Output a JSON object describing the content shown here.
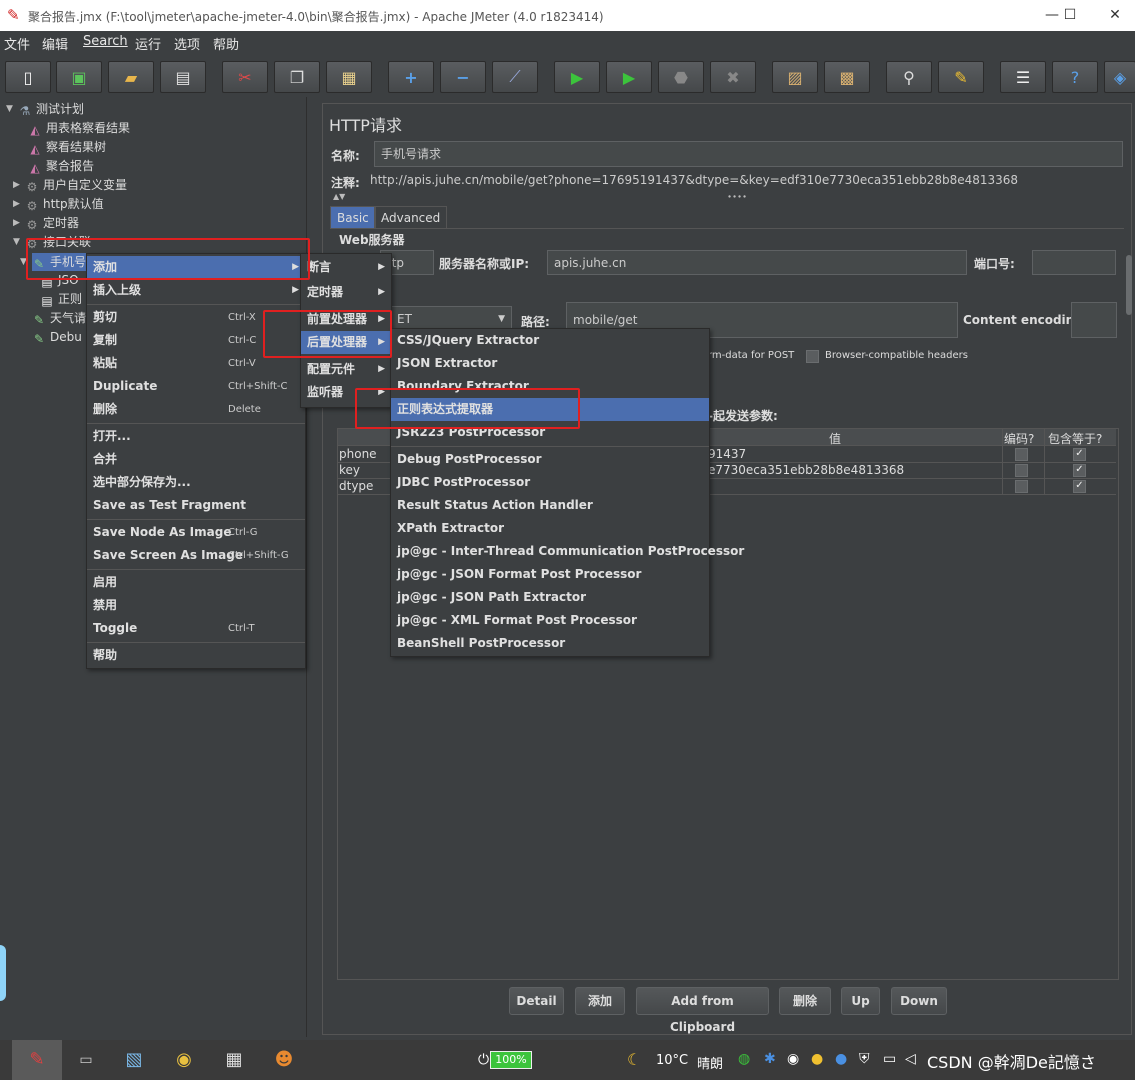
{
  "window": {
    "title": "聚合报告.jmx (F:\\tool\\jmeter\\apache-jmeter-4.0\\bin\\聚合报告.jmx) - Apache JMeter (4.0 r1823414)",
    "minimize": "—",
    "maximize": "☐",
    "close": "✕"
  },
  "menubar": [
    "文件",
    "编辑",
    "Search",
    "运行",
    "选项",
    "帮助"
  ],
  "tree": {
    "items": [
      {
        "label": "测试计划"
      },
      {
        "label": "用表格察看结果"
      },
      {
        "label": "察看结果树"
      },
      {
        "label": "聚合报告"
      },
      {
        "label": "用户自定义变量"
      },
      {
        "label": "http默认值"
      },
      {
        "label": "定时器"
      },
      {
        "label": "接口关联"
      },
      {
        "label": "手机号"
      },
      {
        "label": "JSO"
      },
      {
        "label": "正则"
      },
      {
        "label": "天气请"
      },
      {
        "label": "Debu"
      }
    ]
  },
  "panel": {
    "title": "HTTP请求",
    "name_label": "名称:",
    "name_value": "手机号请求",
    "comment_label": "注释:",
    "comment_value": "http://apis.juhe.cn/mobile/get?phone=17695191437&dtype=&key=edf310e7730eca351ebb28b8e4813368",
    "tabs": [
      "Basic",
      "Advanced"
    ],
    "web_server_label": "Web服务器",
    "protocol_value": "ttp",
    "server_label": "服务器名称或IP:",
    "server_value": "apis.juhe.cn",
    "port_label": "端口号:",
    "method_value": "ET",
    "path_label": "路径:",
    "path_value": "mobile/get",
    "encoding_label": "Content encoding:",
    "multipart_label": "rm-data for POST",
    "browser_headers_label": "Browser-compatible headers",
    "params_label": "-起发送参数:",
    "columns": {
      "value": "值",
      "encode": "编码?",
      "include_equals": "包含等于?"
    },
    "rows": [
      {
        "name": "phone",
        "value": "91437"
      },
      {
        "name": "key",
        "value": "e7730eca351ebb28b8e4813368"
      },
      {
        "name": "dtype",
        "value": ""
      }
    ],
    "buttons": [
      "Detail",
      "添加",
      "Add from Clipboard",
      "删除",
      "Up",
      "Down"
    ]
  },
  "context_menu": {
    "items": [
      {
        "label": "添加",
        "shortcut": ""
      },
      {
        "label": "插入上级",
        "shortcut": ""
      },
      {
        "label": "剪切",
        "shortcut": "Ctrl-X"
      },
      {
        "label": "复制",
        "shortcut": "Ctrl-C"
      },
      {
        "label": "粘贴",
        "shortcut": "Ctrl-V"
      },
      {
        "label": "Duplicate",
        "shortcut": "Ctrl+Shift-C"
      },
      {
        "label": "删除",
        "shortcut": "Delete"
      },
      {
        "label": "打开...",
        "shortcut": ""
      },
      {
        "label": "合并",
        "shortcut": ""
      },
      {
        "label": "选中部分保存为...",
        "shortcut": ""
      },
      {
        "label": "Save as Test Fragment",
        "shortcut": ""
      },
      {
        "label": "Save Node As Image",
        "shortcut": "Ctrl-G"
      },
      {
        "label": "Save Screen As Image",
        "shortcut": "Ctrl+Shift-G"
      },
      {
        "label": "启用",
        "shortcut": ""
      },
      {
        "label": "禁用",
        "shortcut": ""
      },
      {
        "label": "Toggle",
        "shortcut": "Ctrl-T"
      },
      {
        "label": "帮助",
        "shortcut": ""
      }
    ]
  },
  "submenu_add": {
    "items": [
      "断言",
      "定时器",
      "前置处理器",
      "后置处理器",
      "配置元件",
      "监听器"
    ]
  },
  "submenu_post": {
    "items": [
      "CSS/JQuery Extractor",
      "JSON Extractor",
      "Boundary Extractor",
      "正则表达式提取器",
      "JSR223 PostProcessor",
      "Debug PostProcessor",
      "JDBC PostProcessor",
      "Result Status Action Handler",
      "XPath Extractor",
      "jp@gc - Inter-Thread Communication PostProcessor",
      "jp@gc - JSON Format Post Processor",
      "jp@gc - JSON Path Extractor",
      "jp@gc - XML Format Post Processor",
      "BeanShell PostProcessor"
    ]
  },
  "taskbar": {
    "battery": "100%",
    "temperature": "10°C",
    "weather": "晴朗",
    "watermark": "CSDN @幹凋De記憶さ"
  },
  "colors": {
    "selection": "#4b6eaf",
    "highlight_box": "#e02020",
    "background": "#3c3f41"
  }
}
